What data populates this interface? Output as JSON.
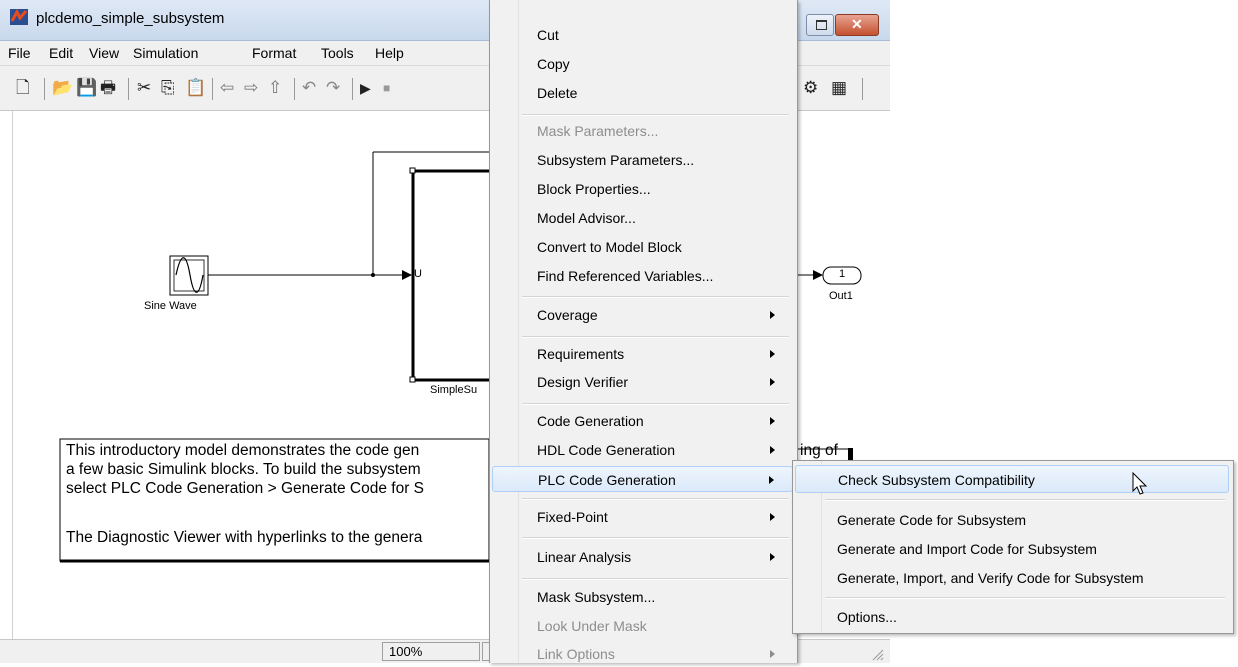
{
  "window": {
    "title": "plcdemo_simple_subsystem"
  },
  "menubar": [
    "File",
    "Edit",
    "View",
    "Simulation",
    "Format",
    "Tools",
    "Help"
  ],
  "diagram": {
    "sine_label": "Sine Wave",
    "subsystem_port_label": "U",
    "subsystem_label": "SimpleSu",
    "outport_number": "1",
    "outport_label": "Out1",
    "note_lines": [
      "This introductory model demonstrates the code gen",
      "a few basic Simulink blocks.  To build the subsystem",
      "select PLC Code Generation > Generate Code for S",
      "",
      "The Diagnostic Viewer with hyperlinks to the genera"
    ],
    "note_right_fragment": "ing of"
  },
  "status": {
    "zoom": "100%"
  },
  "context_menu": {
    "items": [
      {
        "label": "Cut",
        "enabled": true,
        "submenu": false
      },
      {
        "label": "Copy",
        "enabled": true,
        "submenu": false
      },
      {
        "label": "Delete",
        "enabled": true,
        "submenu": false
      },
      {
        "label": "Mask Parameters...",
        "enabled": false,
        "submenu": false
      },
      {
        "label": "Subsystem Parameters...",
        "enabled": true,
        "submenu": false
      },
      {
        "label": "Block Properties...",
        "enabled": true,
        "submenu": false
      },
      {
        "label": "Model Advisor...",
        "enabled": true,
        "submenu": false
      },
      {
        "label": "Convert to Model Block",
        "enabled": true,
        "submenu": false
      },
      {
        "label": "Find Referenced Variables...",
        "enabled": true,
        "submenu": false
      },
      {
        "label": "Coverage",
        "enabled": true,
        "submenu": true
      },
      {
        "label": "Requirements",
        "enabled": true,
        "submenu": true
      },
      {
        "label": "Design Verifier",
        "enabled": true,
        "submenu": true
      },
      {
        "label": "Code Generation",
        "enabled": true,
        "submenu": true
      },
      {
        "label": "HDL Code Generation",
        "enabled": true,
        "submenu": true
      },
      {
        "label": "PLC Code Generation",
        "enabled": true,
        "submenu": true,
        "highlighted": true
      },
      {
        "label": "Fixed-Point",
        "enabled": true,
        "submenu": true
      },
      {
        "label": "Linear Analysis",
        "enabled": true,
        "submenu": true
      },
      {
        "label": "Mask Subsystem...",
        "enabled": true,
        "submenu": false
      },
      {
        "label": "Look Under Mask",
        "enabled": false,
        "submenu": false
      },
      {
        "label": "Link Options",
        "enabled": false,
        "submenu": true
      }
    ]
  },
  "submenu": {
    "items": [
      {
        "label": "Check Subsystem Compatibility",
        "highlighted": true
      },
      {
        "label": "Generate Code for Subsystem"
      },
      {
        "label": "Generate and Import Code for Subsystem"
      },
      {
        "label": "Generate, Import, and Verify Code for Subsystem"
      },
      {
        "label": "Options..."
      }
    ]
  }
}
